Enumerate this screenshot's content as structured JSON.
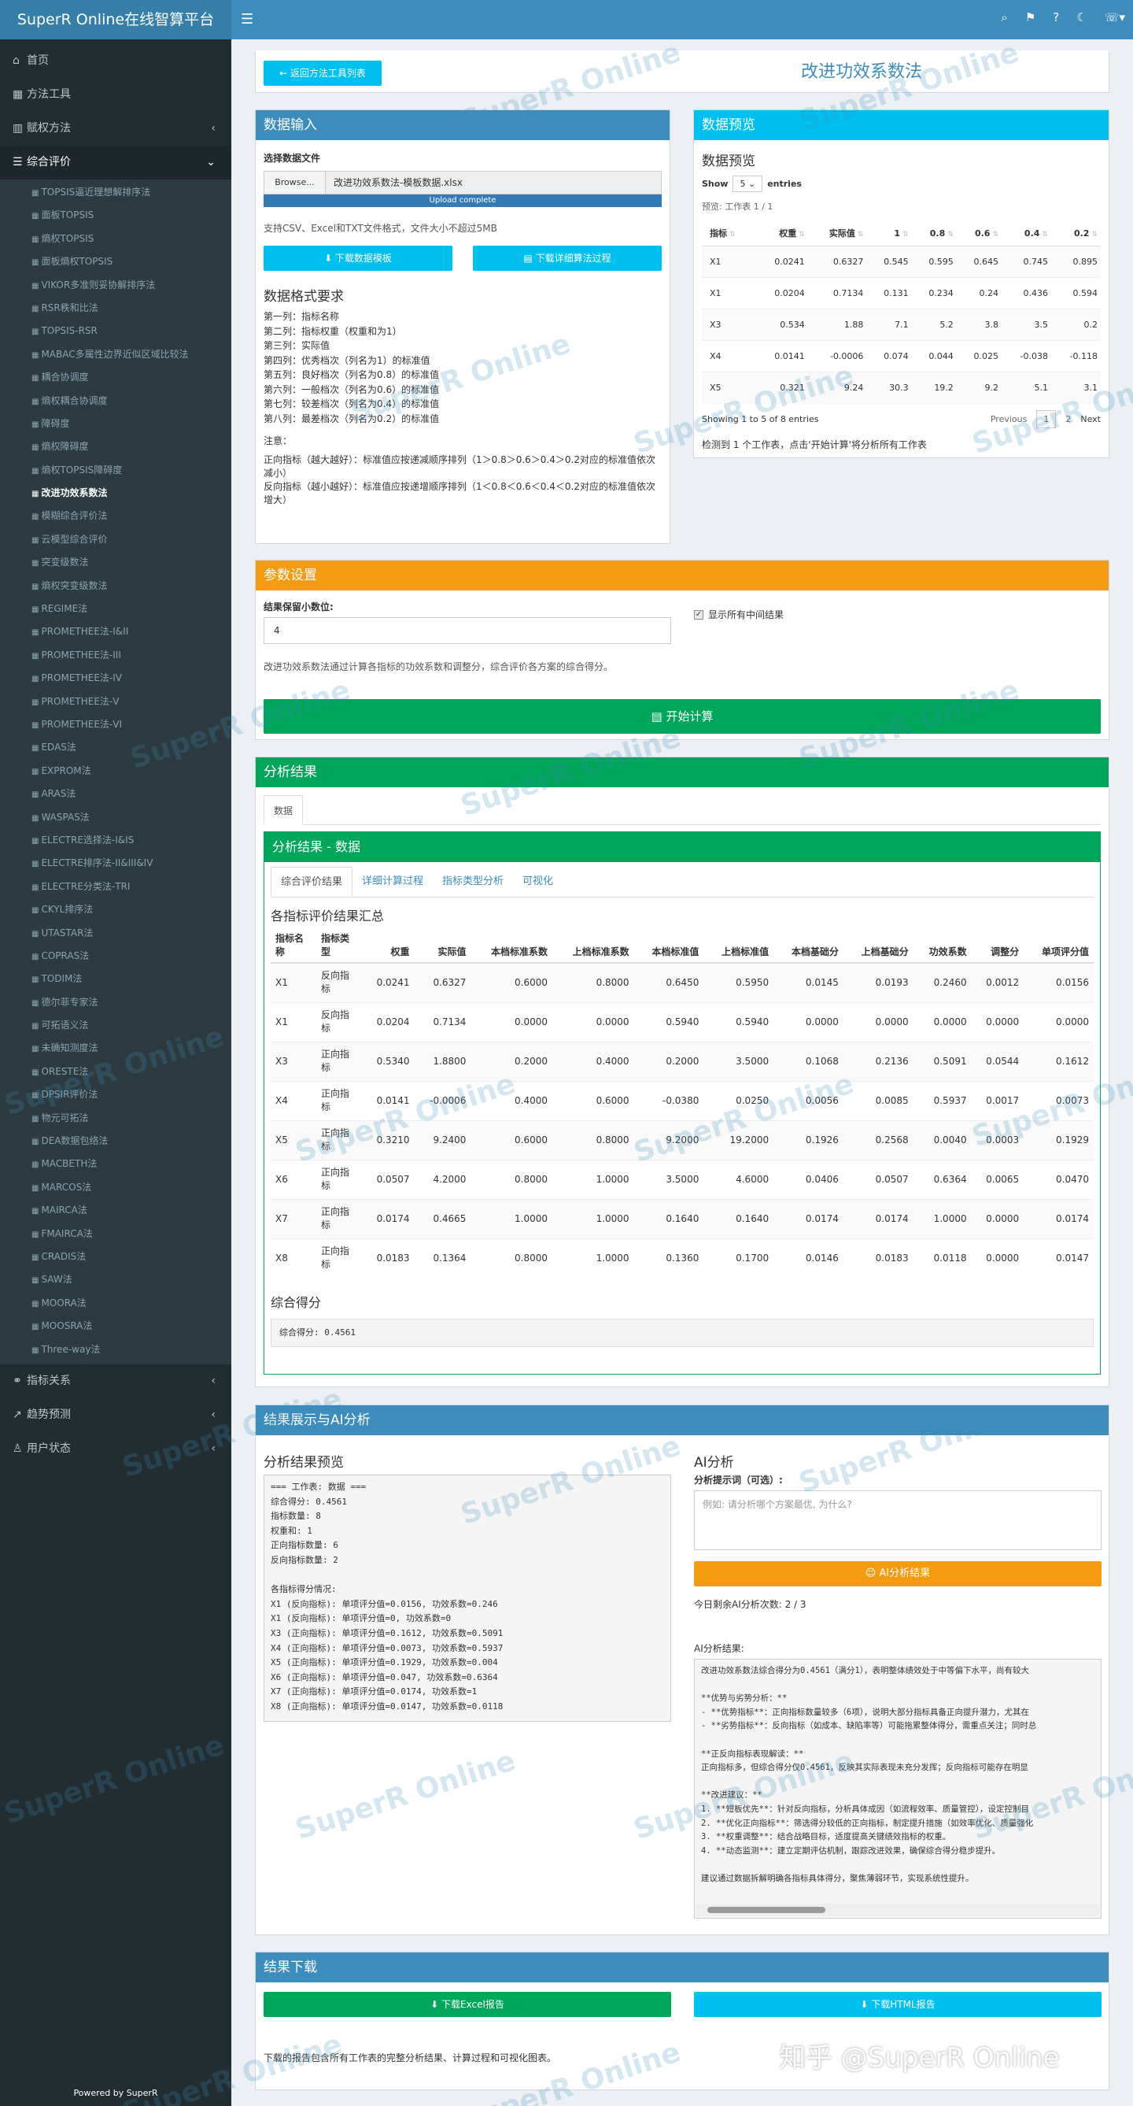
{
  "app": {
    "title": "SuperR Online在线智算平台",
    "powered": "Powered by SuperR"
  },
  "sidebar": {
    "top": [
      {
        "icon": "home-icon",
        "glyph": "⌂",
        "label": "首页"
      },
      {
        "icon": "table-icon",
        "glyph": "▦",
        "label": "方法工具"
      },
      {
        "icon": "chart-icon",
        "glyph": "▥",
        "label": "赋权方法"
      }
    ],
    "open": {
      "icon": "list-icon",
      "glyph": "☰",
      "label": "综合评价"
    },
    "sub": [
      "TOPSIS逼近理想解排序法",
      "面板TOPSIS",
      "熵权TOPSIS",
      "面板熵权TOPSIS",
      "VIKOR多准则妥协解排序法",
      "RSR秩和比法",
      "TOPSIS-RSR",
      "MABAC多属性边界近似区域比较法",
      "耦合协调度",
      "熵权耦合协调度",
      "障碍度",
      "熵权障碍度",
      "熵权TOPSIS障碍度",
      "改进功效系数法",
      "模糊综合评价法",
      "云模型综合评价",
      "突变级数法",
      "熵权突变级数法",
      "REGIME法",
      "PROMETHEE法-I&II",
      "PROMETHEE法-III",
      "PROMETHEE法-IV",
      "PROMETHEE法-V",
      "PROMETHEE法-VI",
      "EDAS法",
      "EXPROM法",
      "ARAS法",
      "WASPAS法",
      "ELECTRE选择法-I&IS",
      "ELECTRE排序法-II&III&IV",
      "ELECTRE分类法-TRI",
      "CKYL排序法",
      "UTASTAR法",
      "COPRAS法",
      "TODIM法",
      "德尔菲专家法",
      "可拓语义法",
      "未确知测度法",
      "ORESTE法",
      "DPSIR评价法",
      "物元可拓法",
      "DEA数据包络法",
      "MACBETH法",
      "MARCOS法",
      "MAIRCA法",
      "FMAIRCA法",
      "CRADIS法",
      "SAW法",
      "MOORA法",
      "MOOSRA法",
      "Three-way法"
    ],
    "active_index": 13,
    "bottom": [
      {
        "icon": "link-icon",
        "glyph": "⚭",
        "label": "指标关系"
      },
      {
        "icon": "trend-icon",
        "glyph": "↗",
        "label": "趋势预测"
      },
      {
        "icon": "user-icon",
        "glyph": "♙",
        "label": "用户状态"
      }
    ]
  },
  "header": {
    "back_label": "← 返回方法工具列表",
    "page_title": "改进功效系数法"
  },
  "input": {
    "title": "数据输入",
    "file_label": "选择数据文件",
    "browse": "Browse...",
    "file_name": "改进功效系数法-模板数据.xlsx",
    "upload_status": "Upload complete",
    "hint": "支持CSV、Excel和TXT文件格式，文件大小不超过5MB",
    "download_template": "⬇ 下载数据模板",
    "download_algo": "▤ 下载详细算法过程",
    "format_title": "数据格式要求",
    "format_lines": [
      "第一列：指标名称",
      "第二列：指标权重（权重和为1）",
      "第三列：实际值",
      "第四列：优秀档次（列名为1）的标准值",
      "第五列：良好档次（列名为0.8）的标准值",
      "第六列：一般档次（列名为0.6）的标准值",
      "第七列：较差档次（列名为0.4）的标准值",
      "第八列：最差档次（列名为0.2）的标准值"
    ],
    "note_title": "注意：",
    "notes": [
      "正向指标（越大越好）：标准值应按递减顺序排列（1＞0.8＞0.6＞0.4＞0.2对应的标准值依次减小）",
      "反向指标（越小越好）：标准值应按递增顺序排列（1＜0.8＜0.6＜0.4＜0.2对应的标准值依次增大）"
    ]
  },
  "preview": {
    "title": "数据预览",
    "subtitle": "数据预览",
    "show": "Show",
    "entries_value": "5",
    "entries": "entries",
    "sheet": "预览: 工作表 1 / 1",
    "columns": [
      "指标",
      "权重",
      "实际值",
      "1",
      "0.8",
      "0.6",
      "0.4",
      "0.2"
    ],
    "rows": [
      [
        "X1",
        "0.0241",
        "0.6327",
        "0.545",
        "0.595",
        "0.645",
        "0.745",
        "0.895"
      ],
      [
        "X1",
        "0.0204",
        "0.7134",
        "0.131",
        "0.234",
        "0.24",
        "0.436",
        "0.594"
      ],
      [
        "X3",
        "0.534",
        "1.88",
        "7.1",
        "5.2",
        "3.8",
        "3.5",
        "0.2"
      ],
      [
        "X4",
        "0.0141",
        "-0.0006",
        "0.074",
        "0.044",
        "0.025",
        "-0.038",
        "-0.118"
      ],
      [
        "X5",
        "0.321",
        "9.24",
        "30.3",
        "19.2",
        "9.2",
        "5.1",
        "3.1"
      ]
    ],
    "info": "Showing 1 to 5 of 8 entries",
    "prev": "Previous",
    "page1": "1",
    "page2": "2",
    "next": "Next",
    "detected": "检测到 1 个工作表，点击'开始计算'将分析所有工作表"
  },
  "params": {
    "title": "参数设置",
    "decimals_label": "结果保留小数位:",
    "decimals_value": "4",
    "show_intermediate": "显示所有中间结果",
    "desc": "改进功效系数法通过计算各指标的功效系数和调整分，综合评价各方案的综合得分。",
    "start": "▤ 开始计算"
  },
  "analysis": {
    "title": "分析结果",
    "outer_tab": "数据",
    "inner_title": "分析结果 - 数据",
    "tabs": [
      "综合评价结果",
      "详细计算过程",
      "指标类型分析",
      "可视化"
    ],
    "table_title": "各指标评价结果汇总",
    "columns": [
      "指标名称",
      "指标类型",
      "权重",
      "实际值",
      "本档标准系数",
      "上档标准系数",
      "本档标准值",
      "上档标准值",
      "本档基础分",
      "上档基础分",
      "功效系数",
      "调整分",
      "单项评分值"
    ],
    "rows": [
      [
        "X1",
        "反向指标",
        "0.0241",
        "0.6327",
        "0.6000",
        "0.8000",
        "0.6450",
        "0.5950",
        "0.0145",
        "0.0193",
        "0.2460",
        "0.0012",
        "0.0156"
      ],
      [
        "X1",
        "反向指标",
        "0.0204",
        "0.7134",
        "0.0000",
        "0.0000",
        "0.5940",
        "0.5940",
        "0.0000",
        "0.0000",
        "0.0000",
        "0.0000",
        "0.0000"
      ],
      [
        "X3",
        "正向指标",
        "0.5340",
        "1.8800",
        "0.2000",
        "0.4000",
        "0.2000",
        "3.5000",
        "0.1068",
        "0.2136",
        "0.5091",
        "0.0544",
        "0.1612"
      ],
      [
        "X4",
        "正向指标",
        "0.0141",
        "-0.0006",
        "0.4000",
        "0.6000",
        "-0.0380",
        "0.0250",
        "0.0056",
        "0.0085",
        "0.5937",
        "0.0017",
        "0.0073"
      ],
      [
        "X5",
        "正向指标",
        "0.3210",
        "9.2400",
        "0.6000",
        "0.8000",
        "9.2000",
        "19.2000",
        "0.1926",
        "0.2568",
        "0.0040",
        "0.0003",
        "0.1929"
      ],
      [
        "X6",
        "正向指标",
        "0.0507",
        "4.2000",
        "0.8000",
        "1.0000",
        "3.5000",
        "4.6000",
        "0.0406",
        "0.0507",
        "0.6364",
        "0.0065",
        "0.0470"
      ],
      [
        "X7",
        "正向指标",
        "0.0174",
        "0.4665",
        "1.0000",
        "1.0000",
        "0.1640",
        "0.1640",
        "0.0174",
        "0.0174",
        "1.0000",
        "0.0000",
        "0.0174"
      ],
      [
        "X8",
        "正向指标",
        "0.0183",
        "0.1364",
        "0.8000",
        "1.0000",
        "0.1360",
        "0.1700",
        "0.0146",
        "0.0183",
        "0.0118",
        "0.0000",
        "0.0147"
      ]
    ],
    "score_title": "综合得分",
    "score_text": "综合得分: 0.4561"
  },
  "ai": {
    "title": "结果展示与AI分析",
    "preview_title": "分析结果预览",
    "preview_text": "=== 工作表: 数据 ===\n综合得分: 0.4561\n指标数量: 8\n权重和: 1\n正向指标数量: 6\n反向指标数量: 2\n\n各指标得分情况:\nX1 (反向指标): 单项评分值=0.0156, 功效系数=0.246\nX1 (反向指标): 单项评分值=0, 功效系数=0\nX3 (正向指标): 单项评分值=0.1612, 功效系数=0.5091\nX4 (正向指标): 单项评分值=0.0073, 功效系数=0.5937\nX5 (正向指标): 单项评分值=0.1929, 功效系数=0.004\nX6 (正向指标): 单项评分值=0.047, 功效系数=0.6364\nX7 (正向指标): 单项评分值=0.0174, 功效系数=1\nX8 (正向指标): 单项评分值=0.0147, 功效系数=0.0118",
    "ai_title": "AI分析",
    "prompt_label": "分析提示词（可选）:",
    "prompt_placeholder": "例如: 请分析哪个方案最优, 为什么?",
    "ai_button": "☺ AI分析结果",
    "remaining": "今日剩余AI分析次数: 2 / 3",
    "result_label": "AI分析结果:",
    "result_text": "改进功效系数法综合得分为0.4561（满分1），表明整体绩效处于中等偏下水平，尚有较大\n\n**优势与劣势分析：**\n- **优势指标**：正向指标数量较多（6项），说明大部分指标具备正向提升潜力，尤其在\n- **劣势指标**：反向指标（如成本、缺陷率等）可能拖累整体得分，需重点关注；同时总\n\n**正反向指标表现解读：**\n正向指标多，但综合得分仅0.4561，反映其实际表现未充分发挥；反向指标可能存在明显\n\n**改进建议：**\n1. **短板优先**：针对反向指标，分析具体成因（如流程效率、质量管控），设定控制目\n2. **优化正向指标**：筛选得分较低的正向指标，制定提升措施（如效率优化、质量强化\n3. **权重调整**：结合战略目标，适度提高关键绩效指标的权重。\n4. **动态监测**：建立定期评估机制，跟踪改进效果，确保综合得分稳步提升。\n\n建议通过数据拆解明确各指标具体得分，聚焦薄弱环节，实现系统性提升。"
  },
  "download": {
    "title": "结果下载",
    "excel": "⬇ 下载Excel报告",
    "html": "⬇ 下载HTML报告",
    "desc": "下载的报告包含所有工作表的完整分析结果、计算过程和可视化图表。"
  },
  "watermark": {
    "text": "SuperR Online",
    "corner": "知乎 @SuperR Online"
  },
  "colors": {
    "primary": "#3c8dbc",
    "aqua": "#00c0ef",
    "orange": "#f39c12",
    "green": "#00a65a",
    "sidebar": "#222d32"
  }
}
